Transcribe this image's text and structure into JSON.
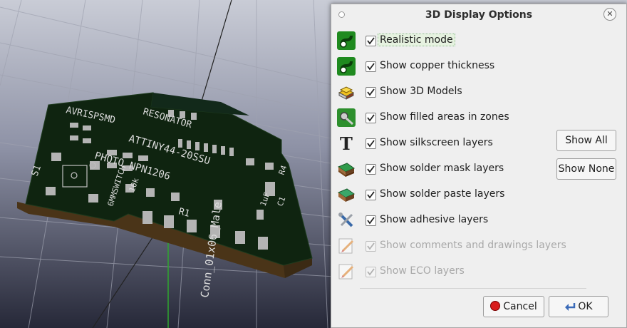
{
  "dialog": {
    "title": "3D Display Options",
    "options": [
      {
        "label": "Realistic mode",
        "checked": true,
        "enabled": true,
        "icon": "realistic-mode-icon"
      },
      {
        "label": "Show copper thickness",
        "checked": true,
        "enabled": true,
        "icon": "copper-thickness-icon"
      },
      {
        "label": "Show 3D Models",
        "checked": true,
        "enabled": true,
        "icon": "3d-models-icon"
      },
      {
        "label": "Show filled areas in zones",
        "checked": true,
        "enabled": true,
        "icon": "filled-zones-icon"
      },
      {
        "label": "Show silkscreen layers",
        "checked": true,
        "enabled": true,
        "icon": "silkscreen-icon"
      },
      {
        "label": "Show solder mask layers",
        "checked": true,
        "enabled": true,
        "icon": "solder-mask-icon"
      },
      {
        "label": "Show solder paste layers",
        "checked": true,
        "enabled": true,
        "icon": "solder-paste-icon"
      },
      {
        "label": "Show adhesive layers",
        "checked": true,
        "enabled": true,
        "icon": "adhesive-icon"
      },
      {
        "label": "Show comments and drawings layers",
        "checked": true,
        "enabled": false,
        "icon": "comments-drawings-icon"
      },
      {
        "label": "Show ECO layers",
        "checked": true,
        "enabled": false,
        "icon": "eco-layers-icon"
      }
    ],
    "show_all_label": "Show All",
    "show_none_label": "Show None",
    "cancel_label": "Cancel",
    "ok_label": "OK"
  },
  "board_silkscreen": {
    "t1": "AVRISPSMD",
    "t2": "RESONATOR",
    "t3": "ATTINY44-20SSU",
    "t4": "PHOTO NPN1206",
    "t5": "10k",
    "t6": "R1",
    "t7": "S1",
    "t8": "6MMSWITCH",
    "t9": "Conn_01x06_Male",
    "t10": "1uF",
    "t11": "C1",
    "t12": "R4"
  },
  "colors": {
    "board": "#0f2410",
    "board_edge": "#3b2a14",
    "pad": "#b4b4b4",
    "silkscreen": "#dcdcdc",
    "dialog_bg": "#efefef"
  }
}
